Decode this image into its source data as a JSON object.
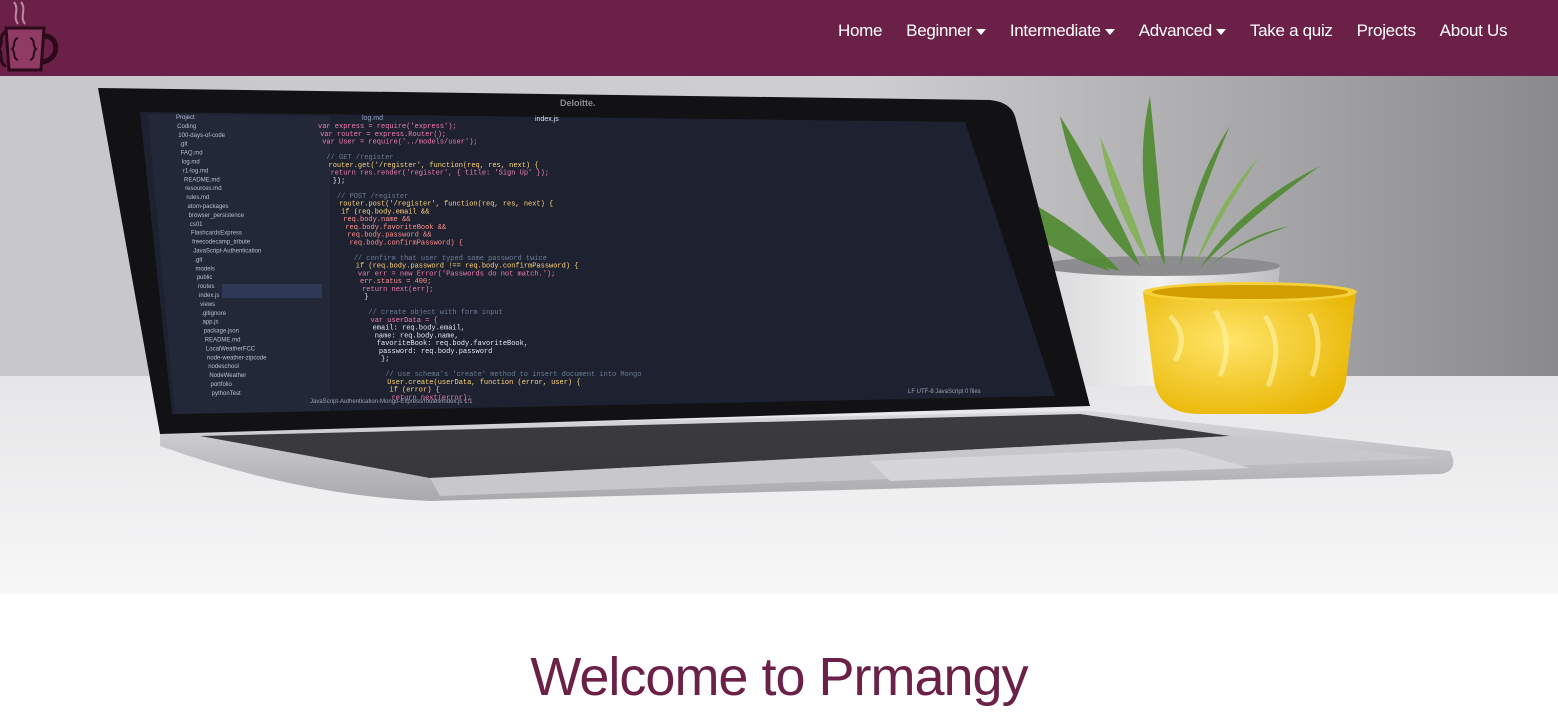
{
  "colors": {
    "brand": "#6b2048",
    "nav_text": "#ffffff"
  },
  "logo": {
    "icon": "coffee-cup-braces-icon"
  },
  "nav": {
    "items": [
      {
        "label": "Home",
        "dropdown": false
      },
      {
        "label": "Beginner",
        "dropdown": true
      },
      {
        "label": "Intermediate",
        "dropdown": true
      },
      {
        "label": "Advanced",
        "dropdown": true
      },
      {
        "label": "Take a quiz",
        "dropdown": false
      },
      {
        "label": "Projects",
        "dropdown": false
      },
      {
        "label": "About Us",
        "dropdown": false
      }
    ]
  },
  "hero": {
    "image": "laptop-code-desk-photo",
    "webcam_label": "Deloitte.",
    "code_lines": [
      "var express = require('express');",
      "var router = express.Router();",
      "var User = require('../models/user');",
      "",
      "// GET /register",
      "router.get('/register', function(req, res, next) {",
      "  return res.render('register', { title: 'Sign Up' });",
      "});",
      "",
      "// POST /register",
      "router.post('/register', function(req, res, next) {",
      "  if (req.body.email &&",
      "    req.body.name &&",
      "    req.body.favoriteBook &&",
      "    req.body.password &&",
      "    req.body.confirmPassword) {",
      "",
      "      // confirm that user typed same password twice",
      "      if (req.body.password !== req.body.confirmPassword) {",
      "        var err = new Error('Passwords do not match.');",
      "        err.status = 400;",
      "        return next(err);",
      "      }",
      "",
      "      // create object with form input",
      "      var userData = {",
      "        email: req.body.email,",
      "        name: req.body.name,",
      "        favoriteBook: req.body.favoriteBook,",
      "        password: req.body.password",
      "      };",
      "",
      "      // use schema's 'create' method to insert document into Mongo",
      "      User.create(userData, function (error, user) {",
      "        if (error) {",
      "          return next(error);"
    ],
    "tree_items": [
      "Project",
      "Coding",
      "100-days-of-code",
      ".git",
      "FAQ.md",
      "log.md",
      "r1-log.md",
      "README.md",
      "resources.md",
      "rules.md",
      "atom-packages",
      "browser_persistence",
      "cs01",
      "FlashcardsExpress",
      "freecodecamp_tribute",
      "JavaScript-Authentication",
      ".git",
      "models",
      "public",
      "routes",
      "index.js",
      "views",
      ".gitignore",
      "app.js",
      "package.json",
      "README.md",
      "LocalWeatherFCC",
      "node-weather-zipcode",
      "nodeschool",
      "NodeWeather",
      "portfolio",
      "pythonTest"
    ],
    "tabs": [
      "log.md",
      "index.js"
    ],
    "status_left": "JavaScript-Authentication-Mongo-Express/routes/index.js   1:1",
    "status_right": "LF   UTF-8   JavaScript   0 files"
  },
  "welcome": {
    "title": "Welcome to Prmangy"
  }
}
